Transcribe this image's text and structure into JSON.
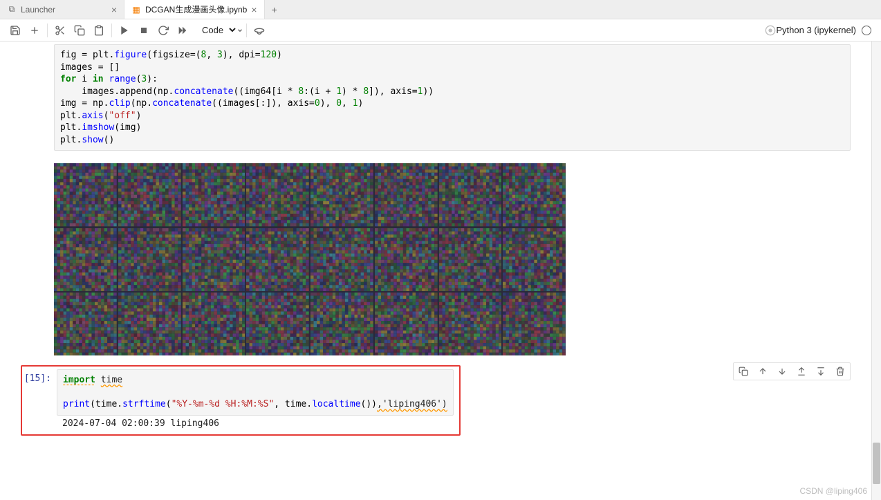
{
  "tabs": [
    {
      "icon": "⧉",
      "label": "Launcher"
    },
    {
      "icon": "▦",
      "label": "DCGAN生成漫画头像.ipynb",
      "active": true
    }
  ],
  "toolbar": {
    "celltype": "Code"
  },
  "kernel": {
    "name": "Python 3 (ipykernel)"
  },
  "cells": {
    "c1": {
      "code_tokens": [
        [
          "name",
          "fig = plt."
        ],
        [
          "func",
          "figure"
        ],
        [
          "name",
          "(figsize="
        ],
        [
          "name",
          "("
        ],
        [
          "num",
          "8"
        ],
        [
          "name",
          ", "
        ],
        [
          "num",
          "3"
        ],
        [
          "name",
          "), dpi="
        ],
        [
          "num",
          "120"
        ],
        [
          "name",
          ")"
        ],
        [
          "nl",
          ""
        ],
        [
          "name",
          "images = []"
        ],
        [
          "nl",
          ""
        ],
        [
          "kw",
          "for"
        ],
        [
          "name",
          " i "
        ],
        [
          "kw",
          "in"
        ],
        [
          "name",
          " "
        ],
        [
          "func",
          "range"
        ],
        [
          "name",
          "("
        ],
        [
          "num",
          "3"
        ],
        [
          "name",
          "):"
        ],
        [
          "nl",
          ""
        ],
        [
          "name",
          "    images.append(np."
        ],
        [
          "func",
          "concatenate"
        ],
        [
          "name",
          "((img64[i * "
        ],
        [
          "num",
          "8"
        ],
        [
          "name",
          ":(i + "
        ],
        [
          "num",
          "1"
        ],
        [
          "name",
          ") * "
        ],
        [
          "num",
          "8"
        ],
        [
          "name",
          "]), axis="
        ],
        [
          "num",
          "1"
        ],
        [
          "name",
          "))"
        ],
        [
          "nl",
          ""
        ],
        [
          "name",
          "img = np."
        ],
        [
          "func",
          "clip"
        ],
        [
          "name",
          "(np."
        ],
        [
          "func",
          "concatenate"
        ],
        [
          "name",
          "((images[:]), axis="
        ],
        [
          "num",
          "0"
        ],
        [
          "name",
          "), "
        ],
        [
          "num",
          "0"
        ],
        [
          "name",
          ", "
        ],
        [
          "num",
          "1"
        ],
        [
          "name",
          ")"
        ],
        [
          "nl",
          ""
        ],
        [
          "name",
          "plt."
        ],
        [
          "func",
          "axis"
        ],
        [
          "name",
          "("
        ],
        [
          "str",
          "\"off\""
        ],
        [
          "name",
          ")"
        ],
        [
          "nl",
          ""
        ],
        [
          "name",
          "plt."
        ],
        [
          "func",
          "imshow"
        ],
        [
          "name",
          "(img)"
        ],
        [
          "nl",
          ""
        ],
        [
          "name",
          "plt."
        ],
        [
          "func",
          "show"
        ],
        [
          "name",
          "()"
        ]
      ]
    },
    "c2": {
      "prompt": "[15]:",
      "code_tokens": [
        [
          "imp",
          "import"
        ],
        [
          "name",
          " "
        ],
        [
          "warn",
          "time"
        ],
        [
          "nl",
          ""
        ],
        [
          "nl",
          ""
        ],
        [
          "func",
          "print"
        ],
        [
          "name",
          "(time."
        ],
        [
          "func",
          "strftime"
        ],
        [
          "name",
          "("
        ],
        [
          "str",
          "\"%Y-%m-%d %H:%M:%S\""
        ],
        [
          "name",
          ", time."
        ],
        [
          "func",
          "localtime"
        ],
        [
          "name",
          "())"
        ],
        [
          "warn",
          ",'liping406')"
        ]
      ],
      "output": "2024-07-04 02:00:39 liping406"
    }
  },
  "footer": "CSDN @liping406"
}
